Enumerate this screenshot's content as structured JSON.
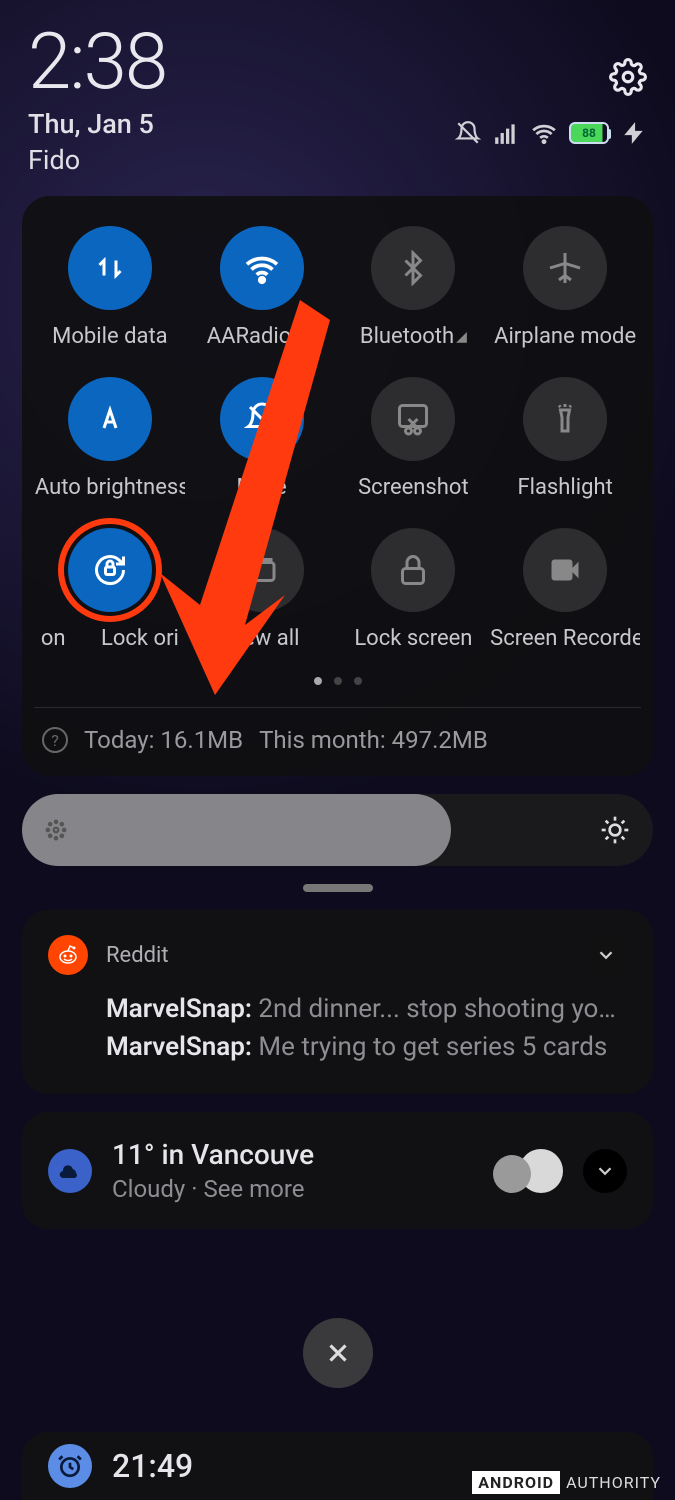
{
  "status": {
    "time": "2:38",
    "date": "Thu, Jan 5",
    "carrier": "Fido",
    "battery": "88"
  },
  "tiles": [
    {
      "label": "Mobile data",
      "on": true
    },
    {
      "label": "AARadio2",
      "on": true,
      "expand": true
    },
    {
      "label": "Bluetooth",
      "on": false,
      "expand": true
    },
    {
      "label": "Airplane mode",
      "on": false
    },
    {
      "label": "Auto brightness",
      "on": true
    },
    {
      "label": "Mute",
      "on": true
    },
    {
      "label": "Screenshot",
      "on": false
    },
    {
      "label": "Flashlight",
      "on": false
    },
    {
      "label": "Lock ori",
      "on": true,
      "prefix": "on",
      "highlight": true
    },
    {
      "label": "View all",
      "on": false
    },
    {
      "label": "Lock screen",
      "on": false
    },
    {
      "label": "Screen Recorder",
      "on": false
    }
  ],
  "data_usage": {
    "today": "Today: 16.1MB",
    "month": "This month: 497.2MB"
  },
  "notif_reddit": {
    "app": "Reddit",
    "line1_bold": "MarvelSnap:",
    "line1_rest": " 2nd dinner... stop shooting you…",
    "line2_bold": "MarvelSnap:",
    "line2_rest": " Me trying to get series 5 cards"
  },
  "weather": {
    "title": "11° in Vancouve",
    "sub": "Cloudy · See more"
  },
  "edge_time": "21:49",
  "watermark": {
    "a": "ANDROID",
    "b": "AUTHORITY"
  }
}
